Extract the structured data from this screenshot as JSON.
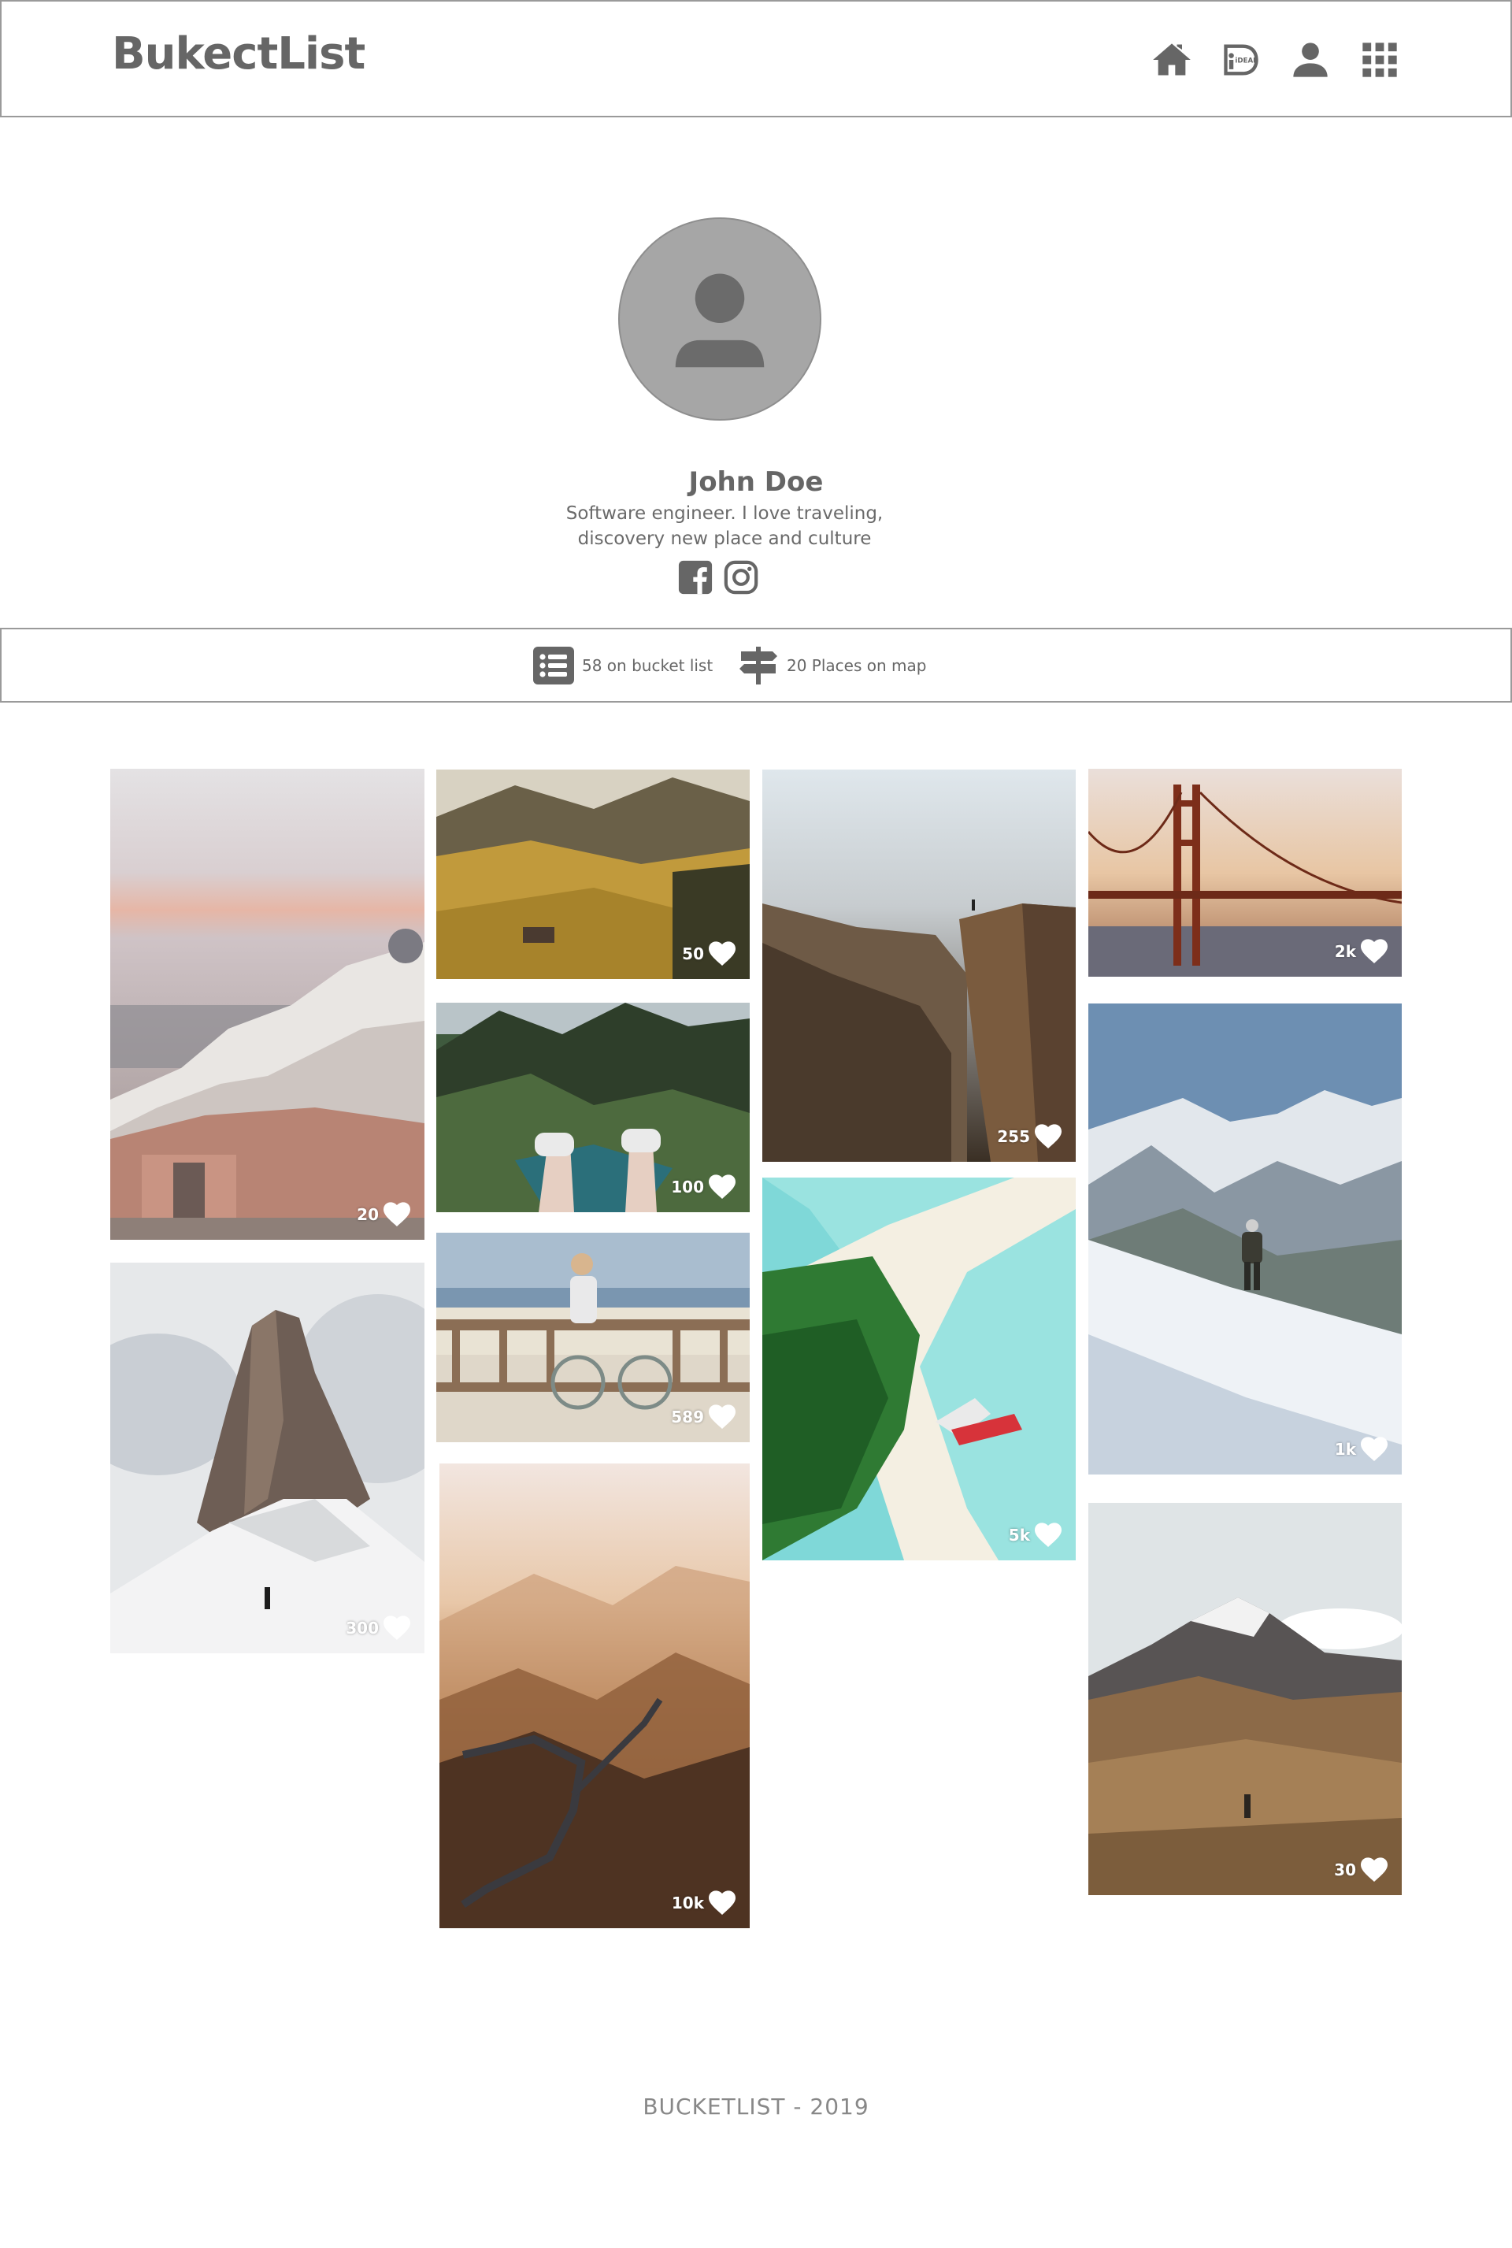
{
  "header": {
    "logo": "BukectList",
    "nav": [
      {
        "name": "home-icon"
      },
      {
        "name": "ideal-icon",
        "badge": "iDEAL"
      },
      {
        "name": "user-icon"
      },
      {
        "name": "grid-icon"
      }
    ]
  },
  "profile": {
    "name": "John Doe",
    "bio": "Software engineer. I love traveling, discovery new place and culture",
    "socials": [
      "facebook-icon",
      "instagram-icon"
    ]
  },
  "stats": {
    "bucket_list": "58 on bucket list",
    "places": "20 Places on map"
  },
  "gallery": [
    {
      "likes": "20",
      "scene": "santorini"
    },
    {
      "likes": "300",
      "scene": "snow-peak"
    },
    {
      "likes": "50",
      "scene": "alpine-meadow"
    },
    {
      "likes": "100",
      "scene": "cliff-feet"
    },
    {
      "likes": "589",
      "scene": "beach-bike"
    },
    {
      "likes": "10k",
      "scene": "great-wall"
    },
    {
      "likes": "255",
      "scene": "canyon-cliff"
    },
    {
      "likes": "5k",
      "scene": "tropical-island"
    },
    {
      "likes": "2k",
      "scene": "golden-gate"
    },
    {
      "likes": "1k",
      "scene": "snow-hiker"
    },
    {
      "likes": "30",
      "scene": "mountain-valley"
    }
  ],
  "footer": "BUCKETLIST - 2019",
  "colors": {
    "primary": "#666666",
    "border": "#9a9a9a"
  }
}
